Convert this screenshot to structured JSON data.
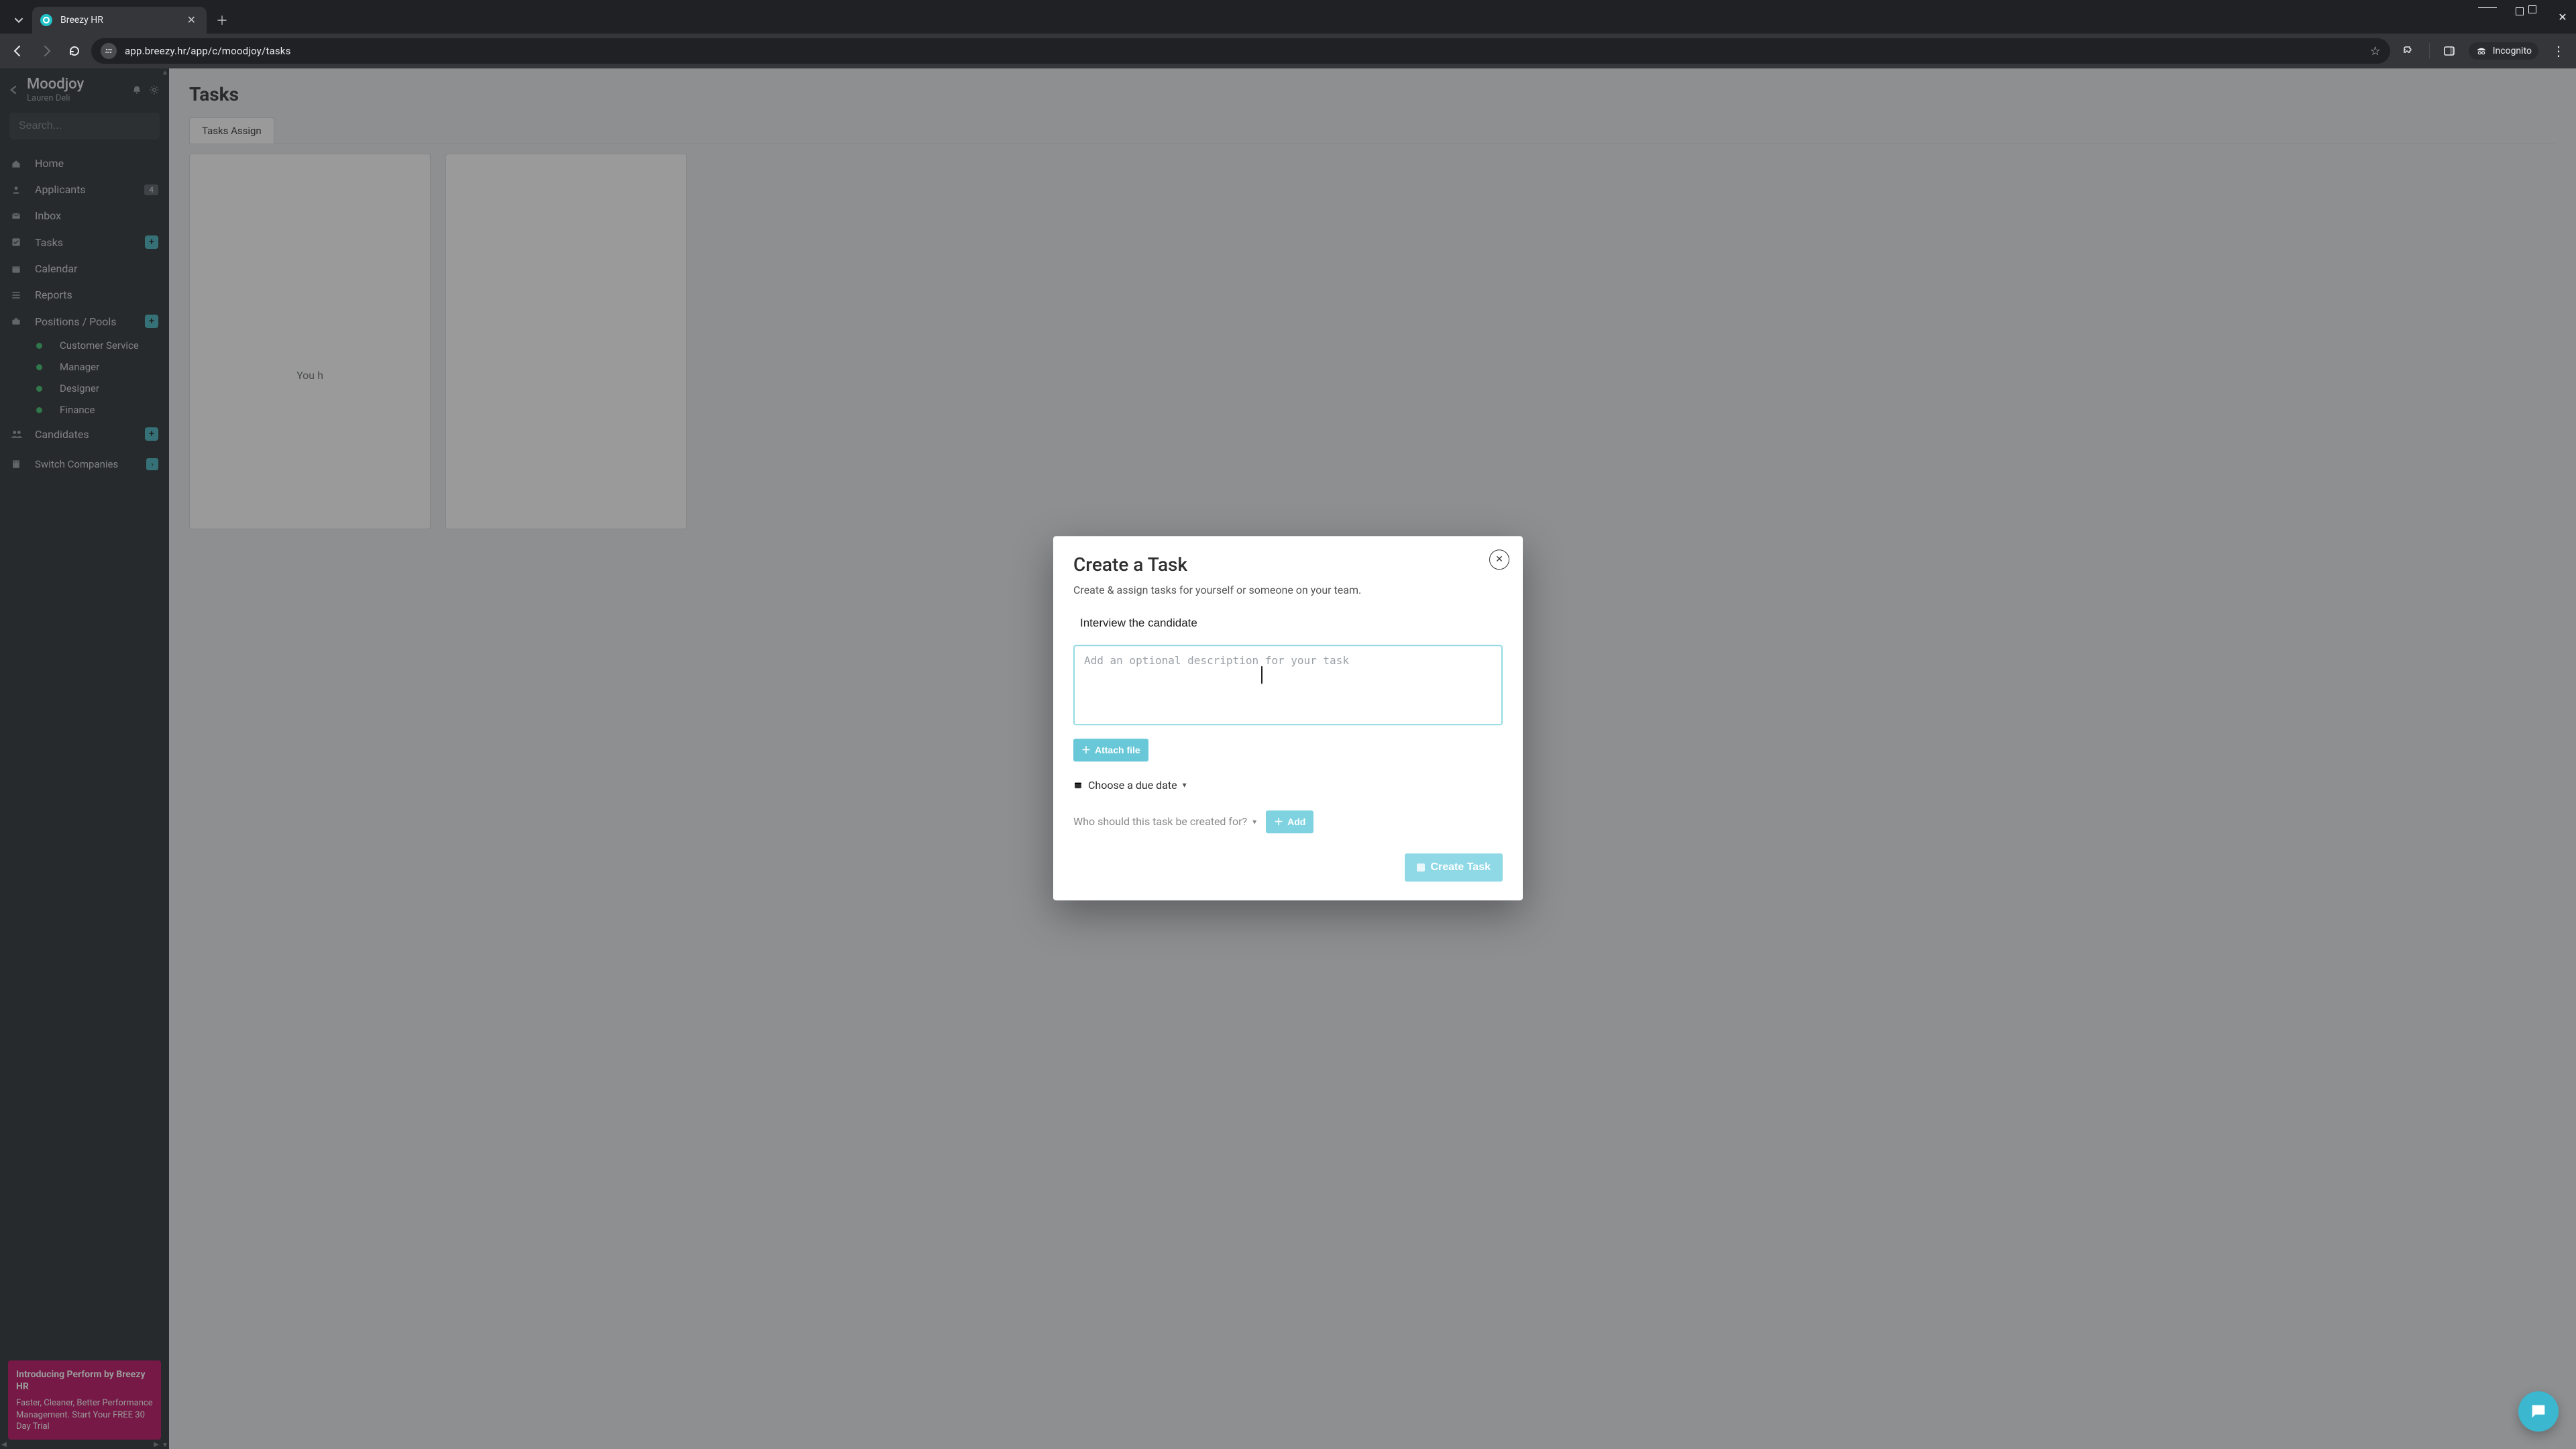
{
  "browser": {
    "tab_title": "Breezy HR",
    "url": "app.breezy.hr/app/c/moodjoy/tasks",
    "incognito_label": "Incognito"
  },
  "sidebar": {
    "company": "Moodjoy",
    "user": "Lauren Deli",
    "search_placeholder": "Search...",
    "items": [
      {
        "icon": "home",
        "label": "Home"
      },
      {
        "icon": "user",
        "label": "Applicants",
        "badge": "4"
      },
      {
        "icon": "mail",
        "label": "Inbox"
      },
      {
        "icon": "check",
        "label": "Tasks",
        "plus": true
      },
      {
        "icon": "calendar",
        "label": "Calendar"
      },
      {
        "icon": "list",
        "label": "Reports"
      },
      {
        "icon": "briefcase",
        "label": "Positions / Pools",
        "plus": true
      }
    ],
    "positions": [
      "Customer Service",
      "Manager",
      "Designer",
      "Finance"
    ],
    "candidates_label": "Candidates",
    "switch_label": "Switch Companies",
    "promo": {
      "title": "Introducing Perform by Breezy HR",
      "body": "Faster, Cleaner, Better Performance Management. Start Your FREE 30 Day Trial"
    }
  },
  "page": {
    "title": "Tasks",
    "visible_tab_partial": "Tasks Assign",
    "empty_hint_partial": "You h"
  },
  "modal": {
    "title": "Create a Task",
    "lead": "Create & assign tasks for yourself or someone on your team.",
    "task_title_value": "Interview the candidate",
    "desc_placeholder": "Add an optional description for your task",
    "attach_label": "Attach file",
    "due_label": "Choose a due date",
    "assign_label": "Who should this task be created for?",
    "add_label": "Add",
    "create_label": "Create Task"
  }
}
